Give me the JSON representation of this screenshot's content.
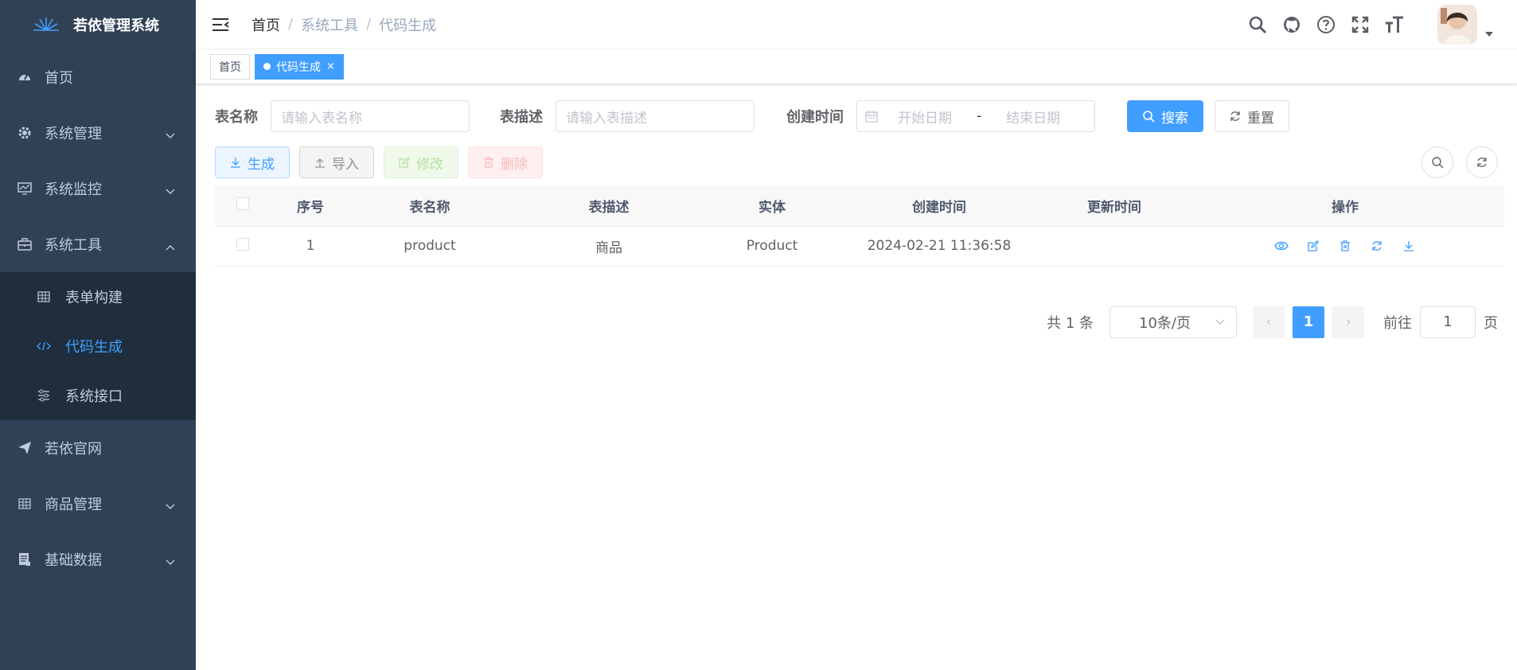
{
  "app": {
    "title": "若依管理系统"
  },
  "sidebar": {
    "items": [
      {
        "label": "首页",
        "icon": "dashboard-icon"
      },
      {
        "label": "系统管理",
        "icon": "gear-icon",
        "expandable": true
      },
      {
        "label": "系统监控",
        "icon": "monitor-icon",
        "expandable": true
      },
      {
        "label": "系统工具",
        "icon": "toolbox-icon",
        "expandable": true,
        "expanded": true,
        "children": [
          {
            "label": "表单构建",
            "icon": "table-icon"
          },
          {
            "label": "代码生成",
            "icon": "code-icon",
            "active": true
          },
          {
            "label": "系统接口",
            "icon": "sliders-icon"
          }
        ]
      },
      {
        "label": "若依官网",
        "icon": "paper-plane-icon"
      },
      {
        "label": "商品管理",
        "icon": "grid-icon",
        "expandable": true
      },
      {
        "label": "基础数据",
        "icon": "document-icon",
        "expandable": true
      }
    ]
  },
  "breadcrumb": {
    "items": [
      "首页",
      "系统工具",
      "代码生成"
    ],
    "separator": "/"
  },
  "tags": [
    {
      "label": "首页",
      "active": false
    },
    {
      "label": "代码生成",
      "active": true,
      "close": "×"
    }
  ],
  "search": {
    "table_name_label": "表名称",
    "table_name_placeholder": "请输入表名称",
    "table_desc_label": "表描述",
    "table_desc_placeholder": "请输入表描述",
    "create_time_label": "创建时间",
    "start_placeholder": "开始日期",
    "range_sep": "-",
    "end_placeholder": "结束日期",
    "search_button": "搜索",
    "reset_button": "重置"
  },
  "toolbar": {
    "generate": "生成",
    "import": "导入",
    "edit": "修改",
    "delete": "删除"
  },
  "table": {
    "columns": [
      "序号",
      "表名称",
      "表描述",
      "实体",
      "创建时间",
      "更新时间",
      "操作"
    ],
    "rows": [
      {
        "index": "1",
        "table_name": "product",
        "table_desc": "商品",
        "entity": "Product",
        "create_time": "2024-02-21 11:36:58",
        "update_time": ""
      }
    ],
    "row_actions": [
      "preview-icon",
      "edit-icon",
      "delete-icon",
      "sync-icon",
      "download-icon"
    ]
  },
  "pagination": {
    "total_text": "共 1 条",
    "page_size": "10条/页",
    "prev": "‹",
    "current": "1",
    "next": "›",
    "goto_label": "前往",
    "goto_value": "1",
    "page_suffix": "页"
  },
  "colors": {
    "primary": "#409eff",
    "sidebar_bg": "#304156",
    "submenu_bg": "#1f2d3d"
  }
}
